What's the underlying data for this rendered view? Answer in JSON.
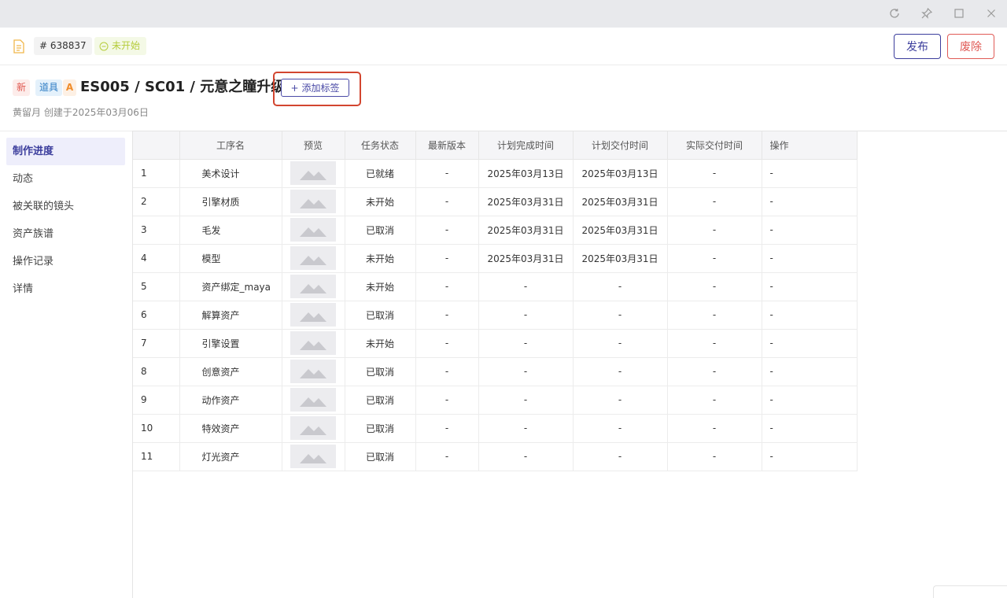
{
  "window_controls": {
    "refresh_icon": "refresh-icon",
    "pin_icon": "pin-icon",
    "maximize_icon": "maximize-icon",
    "close_icon": "close-icon"
  },
  "header": {
    "doc_icon": "document-icon",
    "id": "# 638837",
    "status": "未开始",
    "publish_label": "发布",
    "discard_label": "废除",
    "colors": {
      "publish": "#3b3d9c",
      "discard": "#e05a55",
      "status": "#b5cc3b"
    }
  },
  "title_block": {
    "tags": {
      "new": "新",
      "category": "道具",
      "grade": "A"
    },
    "title": "ES005 / SC01 / 元意之瞳升级",
    "add_tag_label": "添加标签",
    "subtitle": "黄留月 创建于2025年03月06日"
  },
  "sidebar": {
    "items": [
      {
        "label": "制作进度",
        "active": true
      },
      {
        "label": "动态",
        "active": false
      },
      {
        "label": "被关联的镜头",
        "active": false
      },
      {
        "label": "资产族谱",
        "active": false
      },
      {
        "label": "操作记录",
        "active": false
      },
      {
        "label": "详情",
        "active": false
      }
    ]
  },
  "table": {
    "headers": [
      "",
      "工序名",
      "预览",
      "任务状态",
      "最新版本",
      "计划完成时间",
      "计划交付时间",
      "实际交付时间",
      "操作"
    ],
    "rows": [
      {
        "idx": "1",
        "name": "美术设计",
        "status": "已就绪",
        "version": "-",
        "plan_done": "2025年03月13日",
        "plan_deliver": "2025年03月13日",
        "actual": "-",
        "op": "-"
      },
      {
        "idx": "2",
        "name": "引擎材质",
        "status": "未开始",
        "version": "-",
        "plan_done": "2025年03月31日",
        "plan_deliver": "2025年03月31日",
        "actual": "-",
        "op": "-"
      },
      {
        "idx": "3",
        "name": "毛发",
        "status": "已取消",
        "version": "-",
        "plan_done": "2025年03月31日",
        "plan_deliver": "2025年03月31日",
        "actual": "-",
        "op": "-"
      },
      {
        "idx": "4",
        "name": "模型",
        "status": "未开始",
        "version": "-",
        "plan_done": "2025年03月31日",
        "plan_deliver": "2025年03月31日",
        "actual": "-",
        "op": "-"
      },
      {
        "idx": "5",
        "name": "资产绑定_maya",
        "status": "未开始",
        "version": "-",
        "plan_done": "-",
        "plan_deliver": "-",
        "actual": "-",
        "op": "-"
      },
      {
        "idx": "6",
        "name": "解算资产",
        "status": "已取消",
        "version": "-",
        "plan_done": "-",
        "plan_deliver": "-",
        "actual": "-",
        "op": "-"
      },
      {
        "idx": "7",
        "name": "引擎设置",
        "status": "未开始",
        "version": "-",
        "plan_done": "-",
        "plan_deliver": "-",
        "actual": "-",
        "op": "-"
      },
      {
        "idx": "8",
        "name": "创意资产",
        "status": "已取消",
        "version": "-",
        "plan_done": "-",
        "plan_deliver": "-",
        "actual": "-",
        "op": "-"
      },
      {
        "idx": "9",
        "name": "动作资产",
        "status": "已取消",
        "version": "-",
        "plan_done": "-",
        "plan_deliver": "-",
        "actual": "-",
        "op": "-"
      },
      {
        "idx": "10",
        "name": "特效资产",
        "status": "已取消",
        "version": "-",
        "plan_done": "-",
        "plan_deliver": "-",
        "actual": "-",
        "op": "-"
      },
      {
        "idx": "11",
        "name": "灯光资产",
        "status": "已取消",
        "version": "-",
        "plan_done": "-",
        "plan_deliver": "-",
        "actual": "-",
        "op": "-"
      }
    ]
  }
}
